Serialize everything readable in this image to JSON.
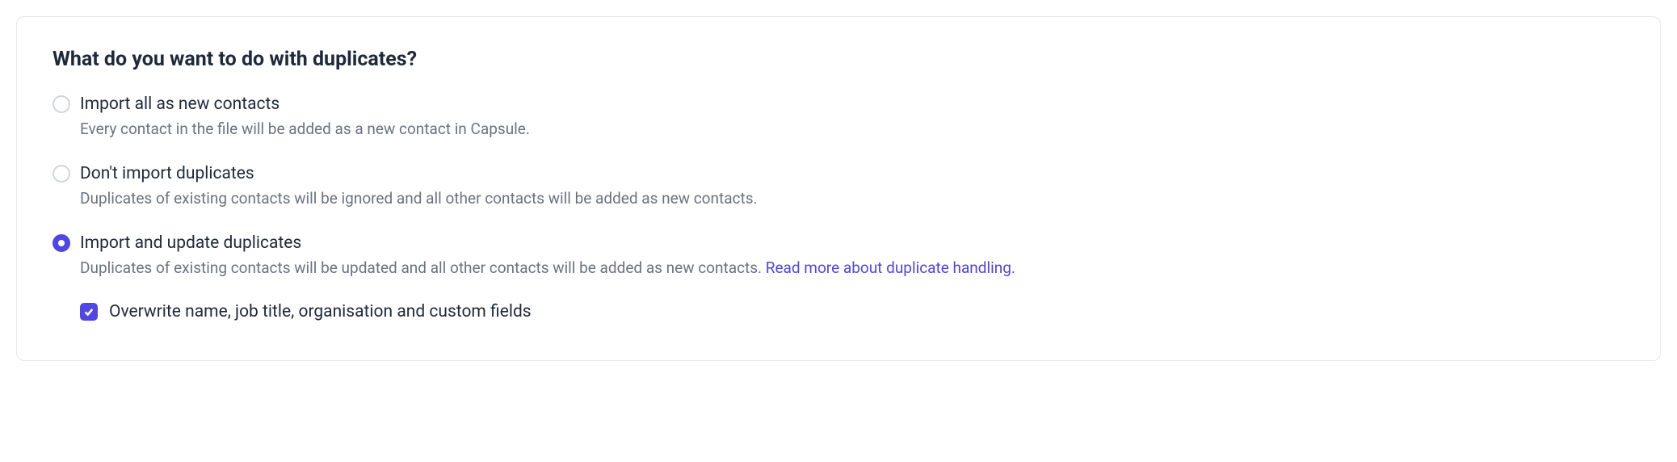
{
  "heading": "What do you want to do with duplicates?",
  "options": {
    "importAll": {
      "label": "Import all as new contacts",
      "desc": "Every contact in the file will be added as a new contact in Capsule."
    },
    "dontImport": {
      "label": "Don't import duplicates",
      "desc": "Duplicates of existing contacts will be ignored and all other contacts will be added as new contacts."
    },
    "importUpdate": {
      "label": "Import and update duplicates",
      "desc": "Duplicates of existing contacts will be updated and all other contacts will be added as new contacts. ",
      "link": "Read more about duplicate handling."
    }
  },
  "checkbox": {
    "label": "Overwrite name, job title, organisation and custom fields"
  }
}
